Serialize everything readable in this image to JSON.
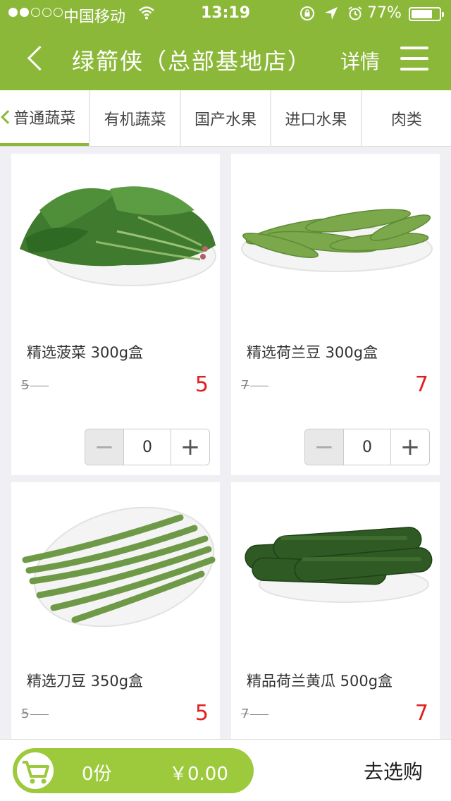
{
  "status": {
    "carrier": "中国移动",
    "time": "13:19",
    "battery": "77%",
    "battery_level": 0.77
  },
  "nav": {
    "title": "绿箭侠（总部基地店）",
    "detail_label": "详情"
  },
  "tabs": [
    {
      "label": "普通蔬菜",
      "active": true
    },
    {
      "label": "有机蔬菜"
    },
    {
      "label": "国产水果"
    },
    {
      "label": "进口水果"
    },
    {
      "label": "肉类"
    }
  ],
  "products": [
    {
      "name": "精选菠菜 300g盒",
      "old_price": "5",
      "price": "5",
      "quantity": "0"
    },
    {
      "name": "精选荷兰豆 300g盒",
      "old_price": "7",
      "price": "7",
      "quantity": "0"
    },
    {
      "name": "精选刀豆 350g盒",
      "old_price": "5",
      "price": "5"
    },
    {
      "name": "精品荷兰黄瓜 500g盒",
      "old_price": "7",
      "price": "7"
    }
  ],
  "stepper": {
    "minus": "−",
    "plus": "+"
  },
  "cart": {
    "count": "0份",
    "total": "￥0.00",
    "checkout_label": "去选购"
  },
  "colors": {
    "brand_green": "#8cb83a",
    "price_red": "#e02020"
  }
}
